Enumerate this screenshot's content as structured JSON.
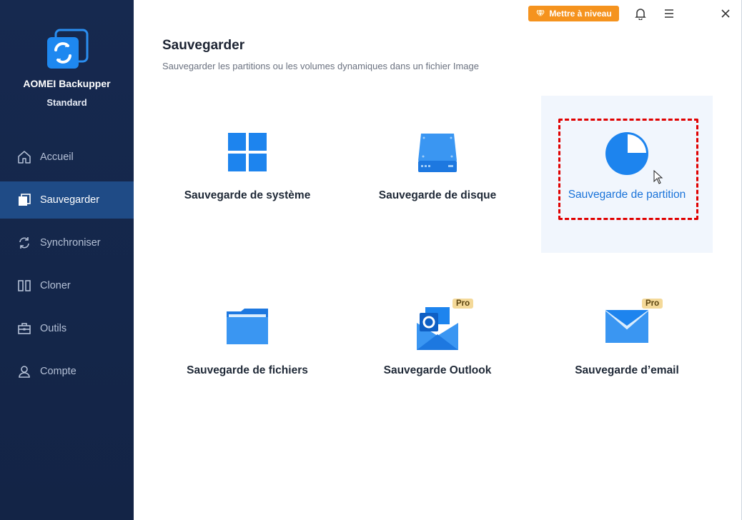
{
  "app": {
    "name": "AOMEI Backupper",
    "edition": "Standard"
  },
  "sidebar": {
    "items": [
      {
        "label": "Accueil",
        "icon": "home-icon",
        "active": false
      },
      {
        "label": "Sauvegarder",
        "icon": "backup-icon",
        "active": true
      },
      {
        "label": "Synchroniser",
        "icon": "sync-icon",
        "active": false
      },
      {
        "label": "Cloner",
        "icon": "clone-icon",
        "active": false
      },
      {
        "label": "Outils",
        "icon": "toolbox-icon",
        "active": false
      },
      {
        "label": "Compte",
        "icon": "user-icon",
        "active": false
      }
    ]
  },
  "topbar": {
    "upgrade_label": "Mettre à niveau"
  },
  "page": {
    "title": "Sauvegarder",
    "subtitle": "Sauvegarder les partitions ou les volumes dynamiques dans un fichier Image"
  },
  "tiles": [
    {
      "label": "Sauvegarde de système",
      "icon": "windows-icon",
      "pro": false
    },
    {
      "label": "Sauvegarde de disque",
      "icon": "disk-icon",
      "pro": false
    },
    {
      "label": "Sauvegarde de partition",
      "icon": "partition-pie-icon",
      "pro": false,
      "selected": true
    },
    {
      "label": "Sauvegarde de fichiers",
      "icon": "folder-icon",
      "pro": false
    },
    {
      "label": "Sauvegarde Outlook",
      "icon": "outlook-icon",
      "pro": true,
      "pro_label": "Pro"
    },
    {
      "label": "Sauvegarde d’email",
      "icon": "email-icon",
      "pro": true,
      "pro_label": "Pro"
    }
  ],
  "colors": {
    "sidebar_bg": "#16294f",
    "active_nav": "#1f4b86",
    "accent": "#1a73d9",
    "upgrade": "#f5931e",
    "highlight_border": "#e00000"
  }
}
